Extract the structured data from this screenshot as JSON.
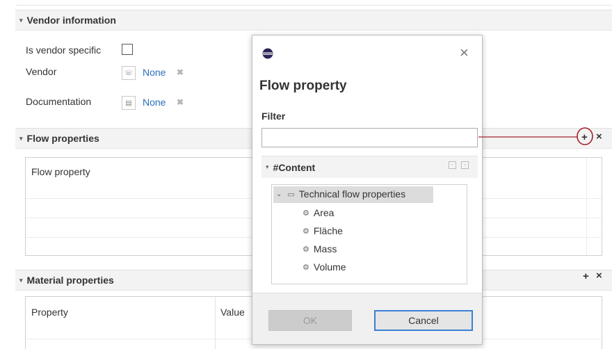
{
  "vendor_section": {
    "title": "Vendor information",
    "is_vendor_specific_label": "Is vendor specific",
    "vendor_label": "Vendor",
    "vendor_value": "None",
    "documentation_label": "Documentation",
    "documentation_value": "None"
  },
  "flow_properties_section": {
    "title": "Flow properties",
    "column_header": "Flow property",
    "add_symbol": "+",
    "remove_symbol": "×"
  },
  "material_properties_section": {
    "title": "Material properties",
    "columns": [
      "Property",
      "Value"
    ],
    "add_symbol": "+",
    "remove_symbol": "×"
  },
  "dialog": {
    "title": "Flow property",
    "filter_label": "Filter",
    "filter_value": "",
    "content_group": "#Content",
    "tree": {
      "folder": "Technical flow properties",
      "children": [
        "Area",
        "Fläche",
        "Mass",
        "Volume"
      ]
    },
    "ok_label": "OK",
    "cancel_label": "Cancel",
    "close_symbol": "×"
  },
  "colors": {
    "link": "#2a6ebb",
    "annotation": "#a3202a",
    "selection": "#dcdcdc",
    "primary_border": "#3b7fd4"
  }
}
